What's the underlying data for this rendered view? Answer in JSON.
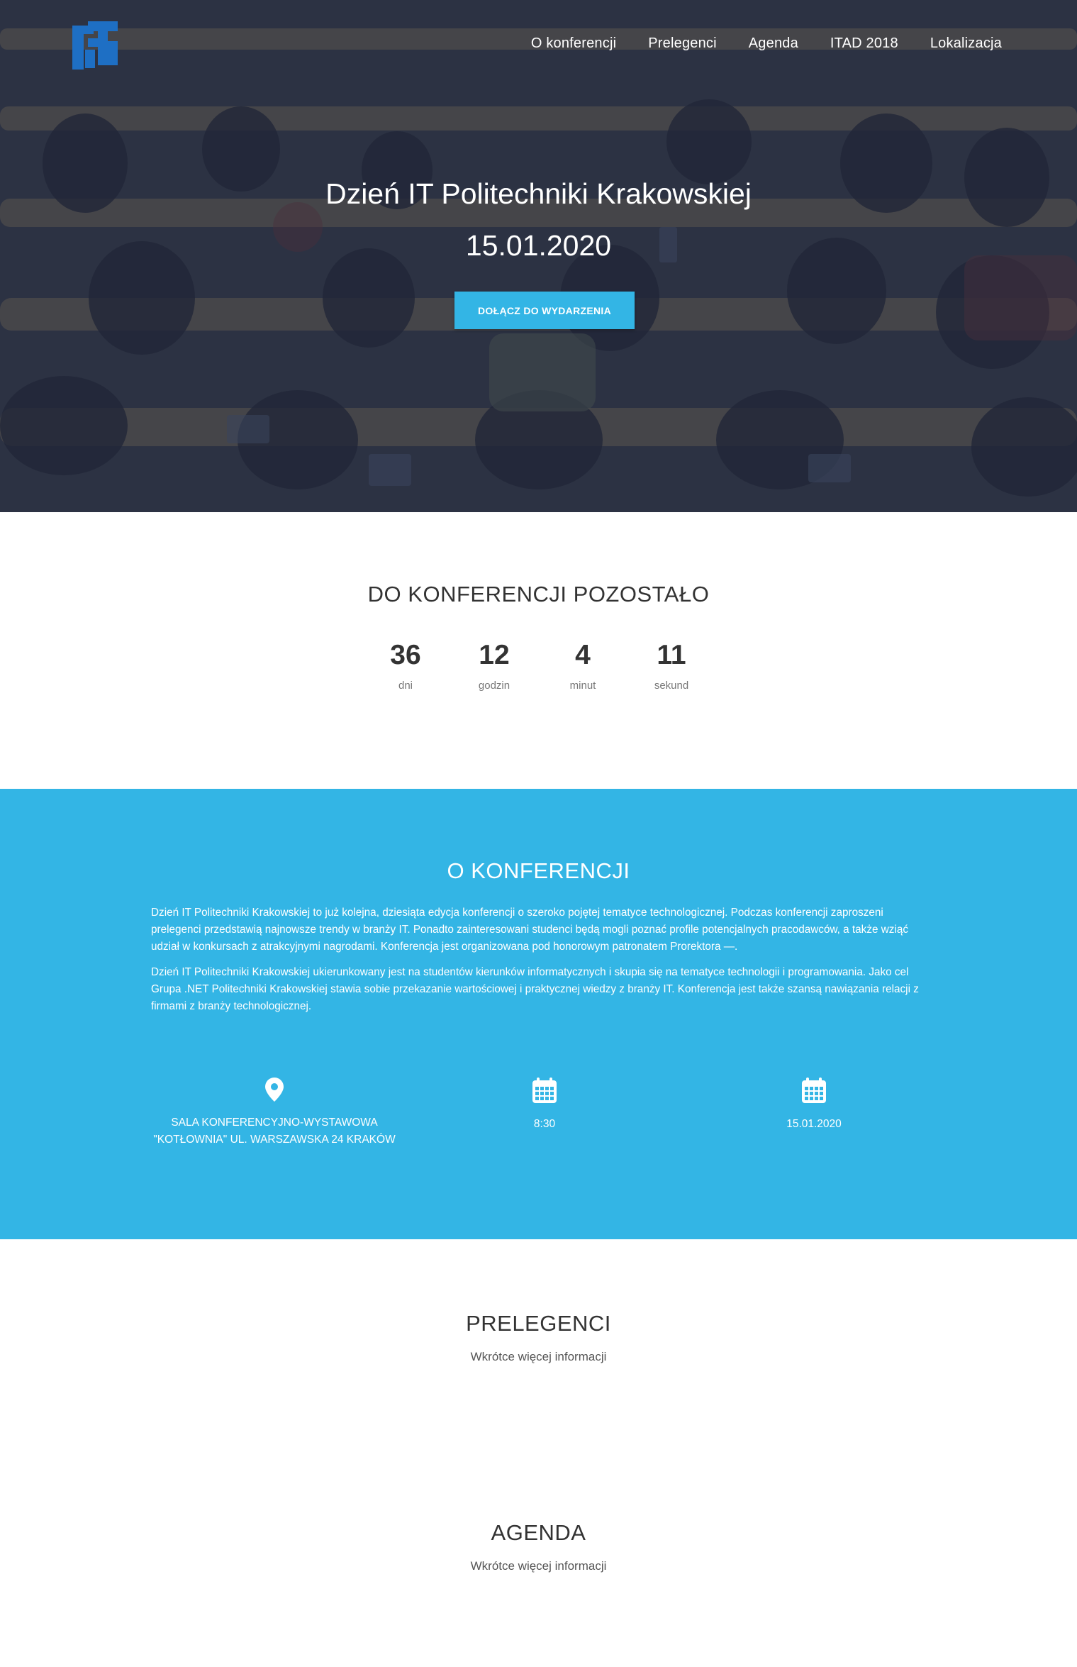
{
  "nav": {
    "items": [
      "O konferencji",
      "Prelegenci",
      "Agenda",
      "ITAD 2018",
      "Lokalizacja"
    ]
  },
  "hero": {
    "title": "Dzień IT Politechniki Krakowskiej",
    "date": "15.01.2020",
    "cta_label": "DOŁĄCZ DO WYDARZENIA"
  },
  "countdown": {
    "title": "DO KONFERENCJI POZOSTAŁO",
    "items": [
      {
        "value": "36",
        "label": "dni"
      },
      {
        "value": "12",
        "label": "godzin"
      },
      {
        "value": "4",
        "label": "minut"
      },
      {
        "value": "11",
        "label": "sekund"
      }
    ]
  },
  "about": {
    "title": "O KONFERENCJI",
    "paragraphs": [
      "Dzień IT Politechniki Krakowskiej to już kolejna, dziesiąta edycja konferencji o szeroko pojętej tematyce technologicznej. Podczas konferencji zaproszeni prelegenci przedstawią najnowsze trendy w branży IT. Ponadto zainteresowani studenci będą mogli poznać profile potencjalnych pracodawców, a także wziąć udział w konkursach z atrakcyjnymi nagrodami. Konferencja jest organizowana pod honorowym patronatem Prorektora —.",
      "Dzień IT Politechniki Krakowskiej ukierunkowany jest na studentów kierunków informatycznych i skupia się na tematyce technologii i programowania. Jako cel Grupa .NET Politechniki Krakowskiej stawia sobie przekazanie wartościowej i praktycznej wiedzy z branży IT. Konferencja jest także szansą nawiązania relacji z firmami z branży technologicznej."
    ],
    "info": [
      {
        "icon": "map-pin-icon",
        "line1": "SALA KONFERENCYJNO-WYSTAWOWA",
        "line2": "\"KOTŁOWNIA\" UL. WARSZAWSKA 24 KRAKÓW"
      },
      {
        "icon": "calendar-icon",
        "line1": "8:30",
        "line2": ""
      },
      {
        "icon": "calendar-icon",
        "line1": "15.01.2020",
        "line2": ""
      }
    ]
  },
  "speakers": {
    "title": "PRELEGENCI",
    "subtitle": "Wkrótce więcej informacji"
  },
  "agenda": {
    "title": "AGENDA",
    "subtitle": "Wkrótce więcej informacji"
  },
  "colors": {
    "accent": "#33b5e5",
    "logo": "#1e6fc4",
    "hero_overlay": "#242a3e"
  }
}
